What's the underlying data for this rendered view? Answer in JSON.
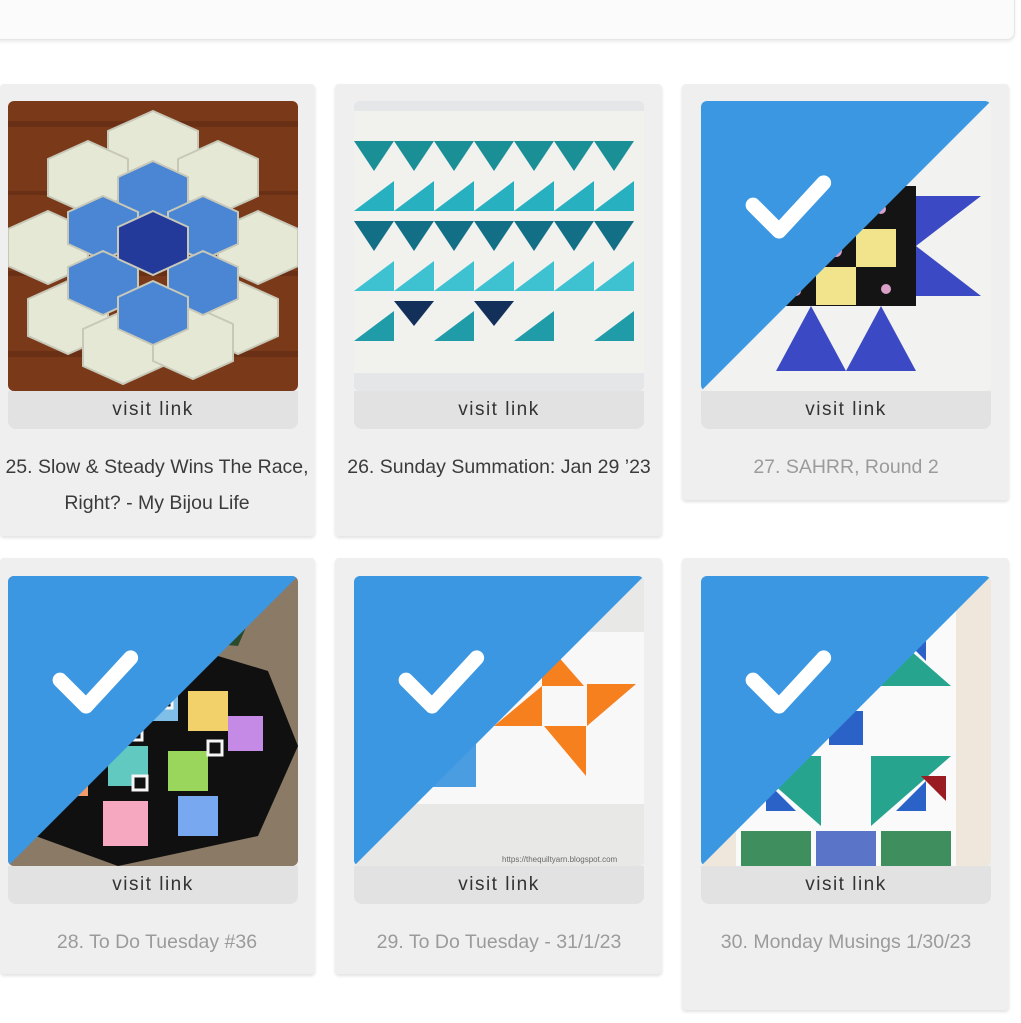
{
  "colors": {
    "card_bg": "#efefef",
    "visit_bg": "#e2e2e2",
    "check_corner": "#3b97e2",
    "title_text": "#3b3b3b",
    "visited_text": "#9b9b9b"
  },
  "items": [
    {
      "title": "25. Slow & Steady Wins The Race, Right? - My Bijou Life",
      "visit_label": "visit link",
      "visited": false,
      "image": "hexagon flower quilt on wooden table"
    },
    {
      "title": "26. Sunday Summation: Jan 29 ’23",
      "visit_label": "visit link",
      "visited": false,
      "image": "teal flying geese quilt runner"
    },
    {
      "title": "27. SAHRR, Round 2",
      "visit_label": "visit link",
      "visited": true,
      "image": "blue and yellow star quilt block"
    },
    {
      "title": "28. To Do Tuesday #36",
      "visit_label": "visit link",
      "visited": true,
      "image": "colorful quilt top on floor near christmas tree"
    },
    {
      "title": "29. To Do Tuesday - 31/1/23",
      "visit_label": "visit link",
      "visited": true,
      "image": "orange pinwheel and color block quilt"
    },
    {
      "title": "30. Monday Musings 1/30/23",
      "visit_label": "visit link",
      "visited": true,
      "image": "green and blue quilt block on wall"
    }
  ],
  "watermark": "https://thequiltyarn.blogspot.com"
}
